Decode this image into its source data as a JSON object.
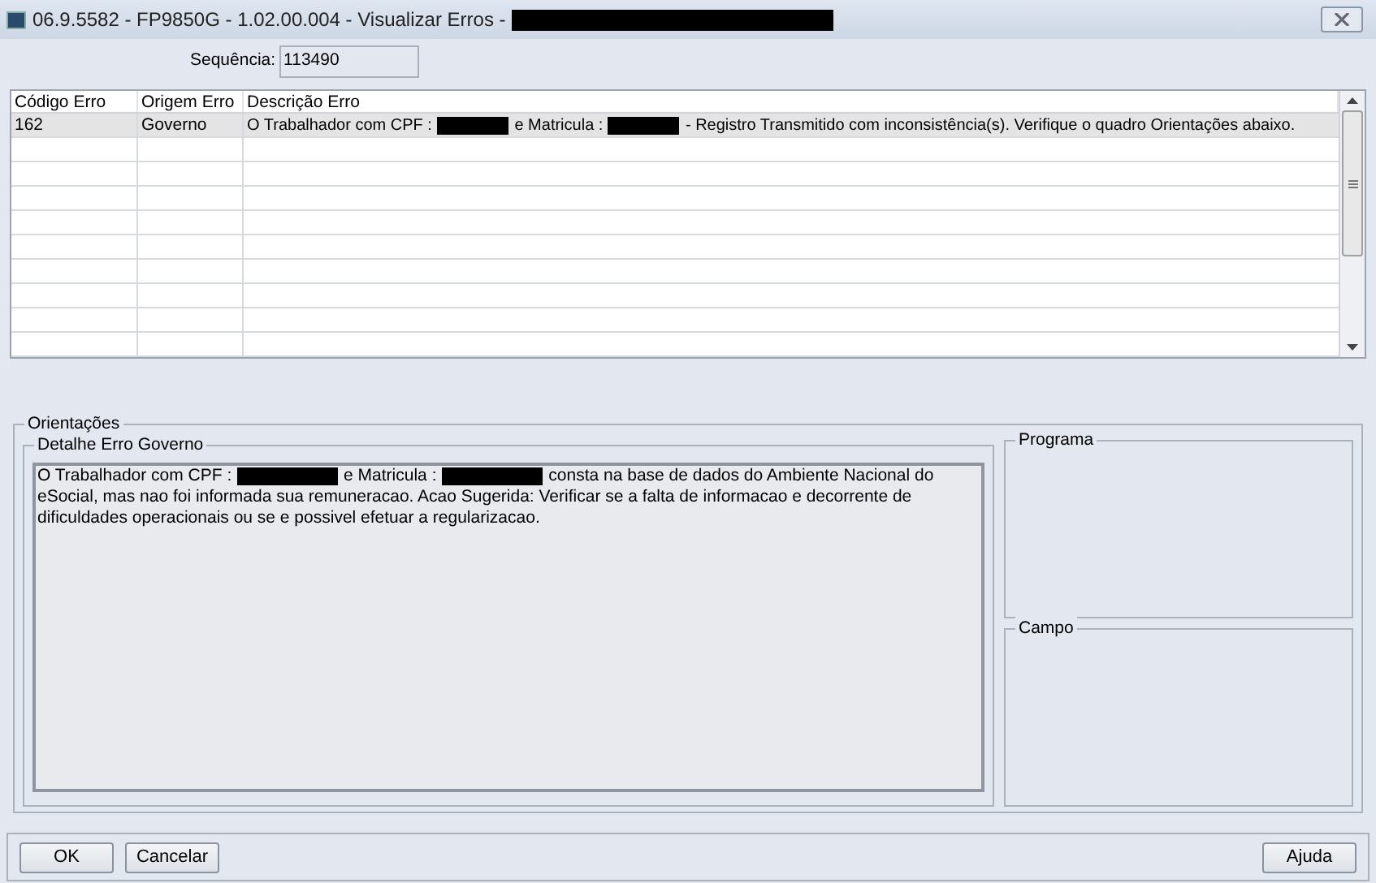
{
  "window": {
    "title": [
      {
        "kind": "text",
        "text": "06.9.5582 - FP9850G - 1.02.00.004 - Visualizar Erros -"
      },
      {
        "kind": "redacted"
      }
    ]
  },
  "sequence": {
    "label": "Sequência:",
    "value": "113490"
  },
  "table": {
    "columns": [
      "Código Erro",
      "Origem Erro",
      "Descrição Erro"
    ],
    "rows": [
      {
        "selected": true,
        "code": "162",
        "origin": "Governo",
        "description": [
          {
            "kind": "text",
            "text": "O Trabalhador com CPF :"
          },
          {
            "kind": "redacted"
          },
          {
            "kind": "text",
            "text": "e Matricula :"
          },
          {
            "kind": "redacted"
          },
          {
            "kind": "text",
            "text": "- Registro Transmitido com inconsistência(s). Verifique o quadro Orientações abaixo."
          }
        ]
      }
    ]
  },
  "guidance": {
    "title": "Orientações",
    "detail": {
      "title": "Detalhe Erro Governo",
      "text": [
        {
          "kind": "text",
          "text": "O Trabalhador com CPF :"
        },
        {
          "kind": "redacted"
        },
        {
          "kind": "text",
          "text": "e Matricula :"
        },
        {
          "kind": "redacted"
        },
        {
          "kind": "text",
          "text": "consta na base de dados do Ambiente Nacional do eSocial, mas nao foi informada sua remuneracao. Acao Sugerida: Verificar se a falta de informacao e decorrente de dificuldades operacionais ou se e possivel efetuar a regularizacao."
        }
      ]
    },
    "program": {
      "title": "Programa"
    },
    "field": {
      "title": "Campo"
    }
  },
  "buttons": {
    "left": [
      "OK",
      "Cancelar"
    ],
    "right": [
      "Ajuda"
    ]
  }
}
